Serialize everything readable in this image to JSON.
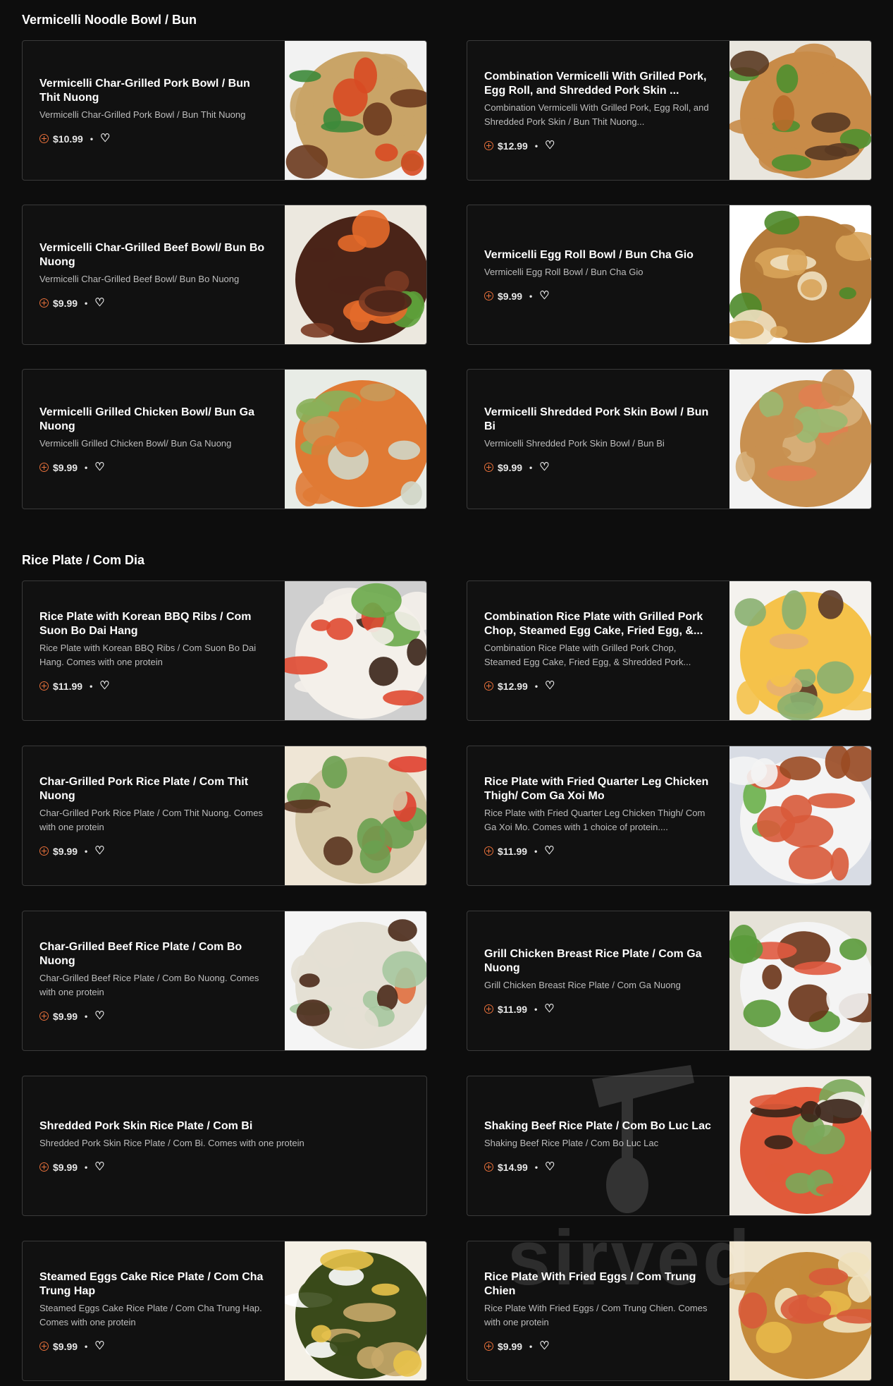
{
  "sections": [
    {
      "title": "Vermicelli Noodle Bowl / Bun",
      "items": [
        {
          "name": "Vermicelli Char-Grilled Pork Bowl / Bun Thit Nuong",
          "desc": "Vermicelli Char-Grilled Pork Bowl / Bun Thit Nuong",
          "price": "$10.99"
        },
        {
          "name": "Combination Vermicelli With Grilled Pork, Egg Roll, and Shredded Pork Skin ...",
          "desc": "Combination Vermicelli With Grilled Pork, Egg Roll, and Shredded Pork Skin / Bun Thit Nuong...",
          "price": "$12.99"
        },
        {
          "name": "Vermicelli Char-Grilled Beef Bowl/ Bun Bo Nuong",
          "desc": "Vermicelli Char-Grilled Beef Bowl/ Bun Bo Nuong",
          "price": "$9.99"
        },
        {
          "name": "Vermicelli Egg Roll Bowl / Bun Cha Gio",
          "desc": "Vermicelli Egg Roll Bowl / Bun Cha Gio",
          "price": "$9.99"
        },
        {
          "name": "Vermicelli Grilled Chicken Bowl/ Bun Ga Nuong",
          "desc": "Vermicelli Grilled Chicken Bowl/ Bun Ga Nuong",
          "price": "$9.99"
        },
        {
          "name": "Vermicelli Shredded Pork Skin Bowl / Bun Bi",
          "desc": "Vermicelli Shredded Pork Skin Bowl / Bun Bi",
          "price": "$9.99"
        }
      ]
    },
    {
      "title": "Rice Plate / Com Dia",
      "items": [
        {
          "name": "Rice Plate with Korean BBQ Ribs / Com Suon Bo Dai Hang",
          "desc": "Rice Plate with Korean BBQ Ribs / Com Suon Bo Dai Hang. Comes with one protein",
          "price": "$11.99"
        },
        {
          "name": "Combination Rice Plate with Grilled Pork Chop, Steamed Egg Cake, Fried Egg, &...",
          "desc": "Combination Rice Plate with Grilled Pork Chop, Steamed Egg Cake, Fried Egg, & Shredded Pork...",
          "price": "$12.99"
        },
        {
          "name": "Char-Grilled Pork Rice Plate / Com Thit Nuong",
          "desc": "Char-Grilled Pork Rice Plate / Com Thit Nuong. Comes with one protein",
          "price": "$9.99"
        },
        {
          "name": "Rice Plate with Fried Quarter Leg Chicken Thigh/ Com Ga Xoi Mo",
          "desc": "Rice Plate with Fried Quarter Leg Chicken Thigh/ Com Ga Xoi Mo. Comes with 1 choice of protein....",
          "price": "$11.99"
        },
        {
          "name": "Char-Grilled Beef Rice Plate / Com Bo Nuong",
          "desc": "Char-Grilled Beef Rice Plate / Com Bo Nuong. Comes with one protein",
          "price": "$9.99"
        },
        {
          "name": "Grill Chicken Breast Rice Plate / Com Ga Nuong",
          "desc": "Grill Chicken Breast Rice Plate / Com Ga Nuong",
          "price": "$11.99"
        },
        {
          "name": "Shredded Pork Skin Rice Plate / Com Bi",
          "desc": "Shredded Pork Skin Rice Plate / Com Bi. Comes with one protein",
          "price": "$9.99"
        },
        {
          "name": "Shaking Beef Rice Plate / Com Bo Luc Lac",
          "desc": "Shaking Beef Rice Plate / Com Bo Luc Lac",
          "price": "$14.99"
        },
        {
          "name": "Steamed Eggs Cake Rice Plate / Com Cha Trung Hap",
          "desc": "Steamed Eggs Cake Rice Plate / Com Cha Trung Hap. Comes with one protein",
          "price": "$9.99"
        },
        {
          "name": "Rice Plate With Fried Eggs / Com Trung Chien",
          "desc": "Rice Plate With Fried Eggs / Com Trung Chien. Comes with one protein",
          "price": "$9.99"
        }
      ]
    }
  ],
  "separator": "•",
  "watermark": "sirved",
  "colors": {
    "accent": "#e8703a",
    "background": "#0d0d0d",
    "card_border": "#3a3a3a"
  }
}
